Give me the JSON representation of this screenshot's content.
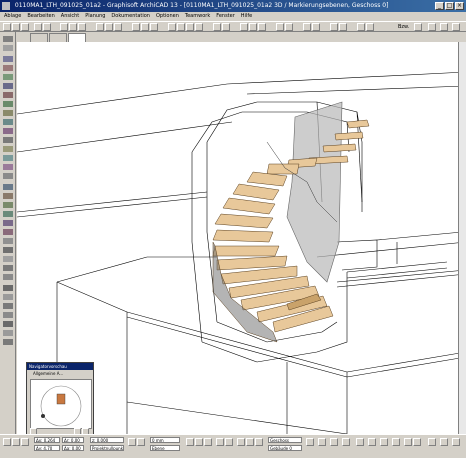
{
  "window": {
    "title": "0110MA1_LTH_091025_01a2 - Graphisoft ArchiCAD 13 - [0110MA1_LTH_091025_01a2 3D / Markierungsebenen, Geschoss 0]",
    "controls": [
      "_",
      "□",
      "×"
    ]
  },
  "menu": [
    "Ablage",
    "Bearbeiten",
    "Ansicht",
    "Planung",
    "Dokumentation",
    "Optionen",
    "Teamwork",
    "Fenster",
    "Hilfe"
  ],
  "toolbar": {
    "zoom_label": "Bzw."
  },
  "tabs": [
    "",
    "",
    ""
  ],
  "nav_palette": {
    "title": "Navigatorvorschau",
    "subtitle": "Allgemeine A..."
  },
  "statusbar": {
    "field1": "Δx: 0,264",
    "field2": "Δy: 4,70",
    "field3": "Δr: 0,00",
    "field4": "Δa: 0,00",
    "field5": "z: 0,000",
    "field6": "Projektnullpunkt",
    "field7": "0 mm",
    "field8": "Ebene",
    "field9": "Geschoss",
    "field10": "Gebäude 0"
  },
  "colors": {
    "title_active": "#0a246a",
    "wood": "#e8c89a",
    "wood_dark": "#c9a26a",
    "glass": "#b8b8b8"
  }
}
